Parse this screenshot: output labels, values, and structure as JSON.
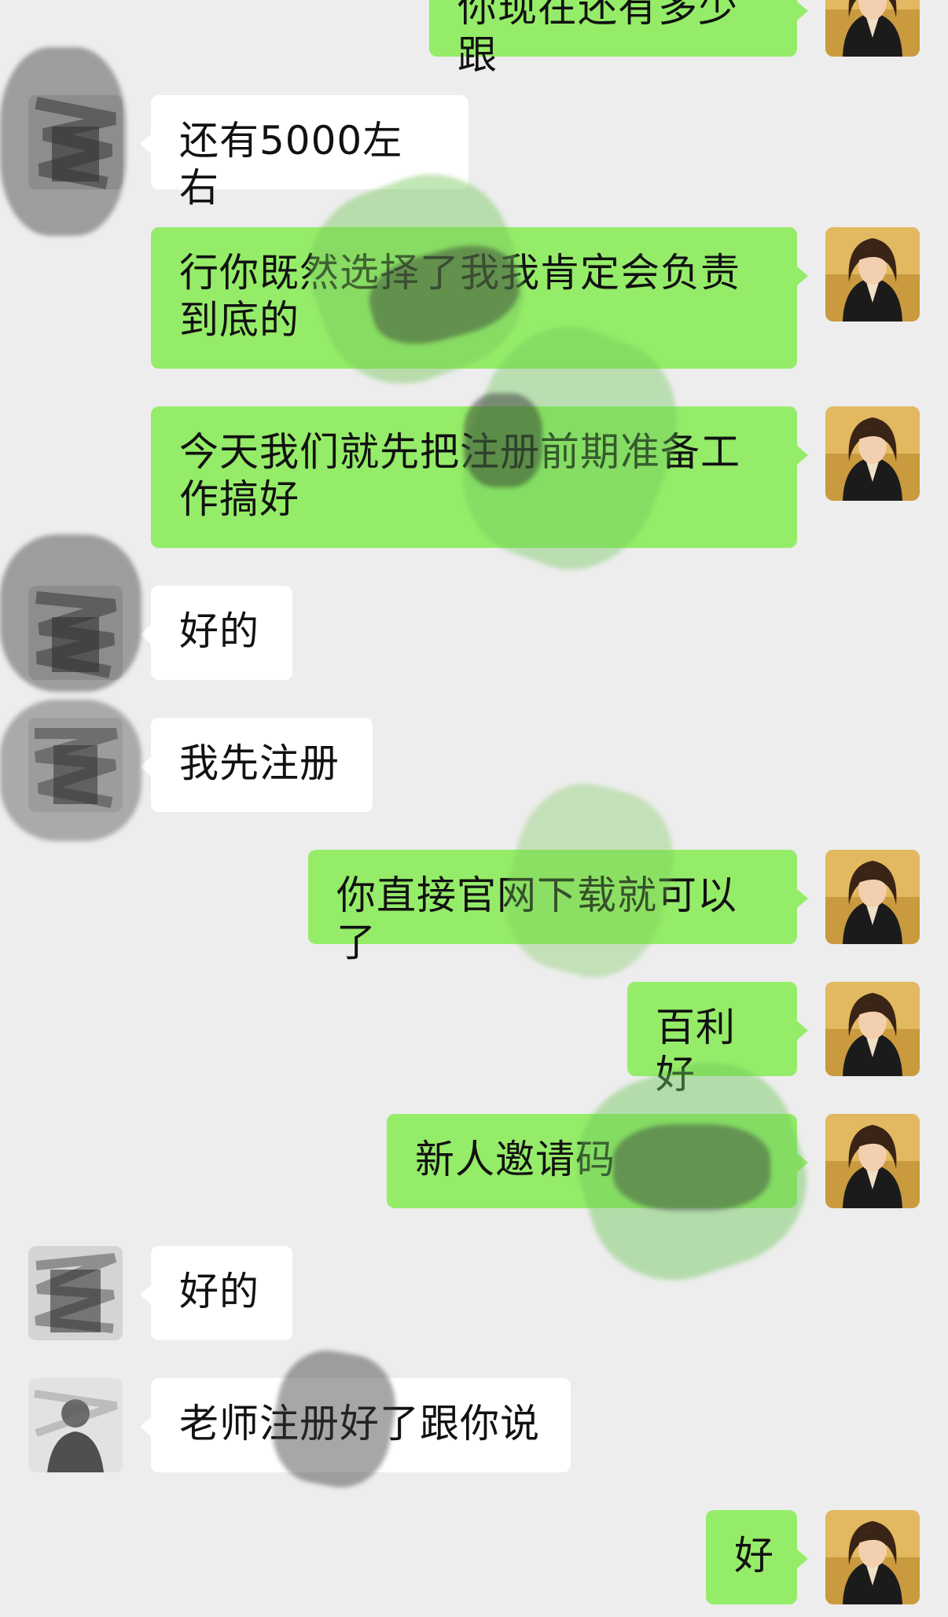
{
  "colors": {
    "background": "#ededed",
    "incoming_bubble": "#ffffff",
    "outgoing_bubble": "#95ec69"
  },
  "messages": [
    {
      "side": "out",
      "text": "你现在还有多少跟",
      "avatar": "woman-portrait-avatar"
    },
    {
      "side": "in",
      "text": "还有5000左右",
      "avatar": "redacted-avatar"
    },
    {
      "side": "out",
      "text": "行你既然选择了我我肯定会负责到底的",
      "avatar": "woman-portrait-avatar"
    },
    {
      "side": "out",
      "text": "今天我们就先把注册前期准备工作搞好",
      "avatar": "woman-portrait-avatar"
    },
    {
      "side": "in",
      "text": "好的",
      "avatar": "redacted-avatar"
    },
    {
      "side": "in",
      "text": "我先注册",
      "avatar": "redacted-avatar"
    },
    {
      "side": "out",
      "text": "你直接官网下载就可以了",
      "avatar": "woman-portrait-avatar"
    },
    {
      "side": "out",
      "text": "百利好",
      "avatar": "woman-portrait-avatar"
    },
    {
      "side": "out",
      "text": "新人邀请码",
      "avatar": "woman-portrait-avatar"
    },
    {
      "side": "in",
      "text": "好的",
      "avatar": "redacted-avatar"
    },
    {
      "side": "in",
      "text": "老师注册好了跟你说",
      "avatar": "redacted-avatar"
    },
    {
      "side": "out",
      "text": "好",
      "avatar": "woman-portrait-avatar"
    }
  ]
}
